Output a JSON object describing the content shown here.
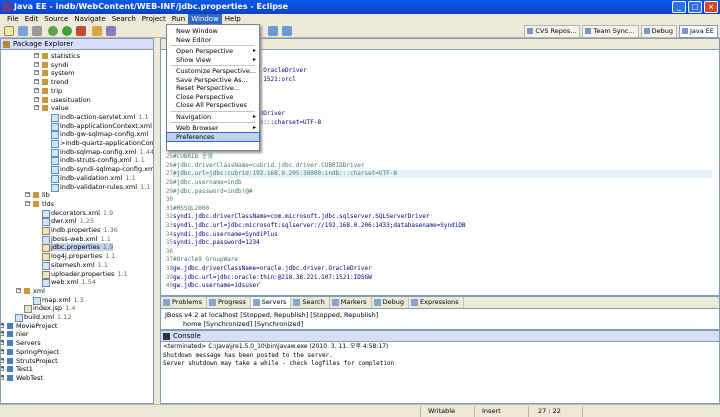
{
  "window": {
    "title": "Java EE - indb/WebContent/WEB-INF/jdbc.properties - Eclipse"
  },
  "menubar": [
    "File",
    "Edit",
    "Source",
    "Navigate",
    "Search",
    "Project",
    "Run",
    "Window",
    "Help"
  ],
  "perspectives": [
    "CVS Repos...",
    "Team Sync...",
    "Debug",
    "Java EE"
  ],
  "window_menu": {
    "items": [
      {
        "label": "New Window",
        "submenu": false
      },
      {
        "label": "New Editor",
        "submenu": false
      },
      {
        "sep": true
      },
      {
        "label": "Open Perspective",
        "submenu": true
      },
      {
        "label": "Show View",
        "submenu": true
      },
      {
        "sep": true
      },
      {
        "label": "Customize Perspective...",
        "submenu": false
      },
      {
        "label": "Save Perspective As...",
        "submenu": false
      },
      {
        "label": "Reset Perspective...",
        "submenu": false
      },
      {
        "label": "Close Perspective",
        "submenu": false
      },
      {
        "label": "Close All Perspectives",
        "submenu": false
      },
      {
        "sep": true
      },
      {
        "label": "Navigation",
        "submenu": true
      },
      {
        "sep": true
      },
      {
        "label": "Web Browser",
        "submenu": true
      },
      {
        "label": "Preferences",
        "submenu": false,
        "highlight": true
      }
    ]
  },
  "package_explorer": {
    "title": "Package Explorer",
    "items": [
      {
        "label": "statistics",
        "type": "pkg",
        "indent": 3
      },
      {
        "label": "syndi",
        "type": "pkg",
        "indent": 3
      },
      {
        "label": "system",
        "type": "pkg",
        "indent": 3
      },
      {
        "label": "trend",
        "type": "pkg",
        "indent": 3
      },
      {
        "label": "trip",
        "type": "pkg",
        "indent": 3
      },
      {
        "label": "usesituation",
        "type": "pkg",
        "indent": 3
      },
      {
        "label": "value",
        "type": "pkg",
        "indent": 3
      },
      {
        "label": "indb-action-servlet.xml",
        "rev": "1.1",
        "type": "xml",
        "indent": 4
      },
      {
        "label": "indb-applicationContext.xml",
        "rev": "",
        "type": "xml",
        "indent": 4
      },
      {
        "label": "indb-gw-sqlmap-config.xml",
        "rev": "",
        "type": "xml",
        "indent": 4
      },
      {
        "label": ">indb-quartz-applicationCont",
        "rev": "",
        "type": "xml",
        "indent": 4
      },
      {
        "label": "indb-sqlmap-config.xml",
        "rev": "1.44",
        "type": "xml",
        "indent": 4
      },
      {
        "label": "indb-struts-config.xml",
        "rev": "1.1",
        "type": "xml",
        "indent": 4
      },
      {
        "label": "indb-syndi-sqlmap-config.xm",
        "rev": "",
        "type": "xml",
        "indent": 4
      },
      {
        "label": "indb-validation.xml",
        "rev": "1.1",
        "type": "xml",
        "indent": 4
      },
      {
        "label": "indb-validator-rules.xml",
        "rev": "1.1",
        "type": "xml",
        "indent": 4
      },
      {
        "label": "lib",
        "type": "pkg",
        "indent": 2
      },
      {
        "label": "tlds",
        "type": "pkg",
        "indent": 2
      },
      {
        "label": "decorators.xml",
        "rev": "1.9",
        "type": "xml",
        "indent": 3
      },
      {
        "label": "dwr.xml",
        "rev": "1.25",
        "type": "xml",
        "indent": 3
      },
      {
        "label": "indb.properties",
        "rev": "1.36",
        "type": "prop",
        "indent": 3
      },
      {
        "label": "jboss-web.xml",
        "rev": "1.1",
        "type": "xml",
        "indent": 3
      },
      {
        "label": "jdbc.properties",
        "rev": "1.9",
        "type": "prop",
        "indent": 3,
        "selected": true
      },
      {
        "label": "log4j.properties",
        "rev": "1.1",
        "type": "prop",
        "indent": 3
      },
      {
        "label": "sitemesh.xml",
        "rev": "1.1",
        "type": "xml",
        "indent": 3
      },
      {
        "label": "uploader.properties",
        "rev": "1.1",
        "type": "prop",
        "indent": 3
      },
      {
        "label": "web.xml",
        "rev": "1.54",
        "type": "xml",
        "indent": 3
      },
      {
        "label": "xml",
        "type": "pkg",
        "indent": 1
      },
      {
        "label": "map.xml",
        "rev": "1.3",
        "type": "xml",
        "indent": 2
      },
      {
        "label": "index.jsp",
        "rev": "1.4",
        "type": "file",
        "indent": 1
      },
      {
        "label": "build.xml",
        "rev": "1.12",
        "type": "xml",
        "indent": 0
      },
      {
        "label": "MovieProject",
        "rev": "",
        "type": "proj",
        "indent": -1
      },
      {
        "label": "nier",
        "rev": "",
        "type": "proj",
        "indent": -1
      },
      {
        "label": "Servers",
        "rev": "",
        "type": "proj",
        "indent": -1
      },
      {
        "label": "SpringProject",
        "rev": "",
        "type": "proj",
        "indent": -1
      },
      {
        "label": "StrutsProject",
        "rev": "",
        "type": "proj",
        "indent": -1
      },
      {
        "label": "Test1",
        "rev": "",
        "type": "proj",
        "indent": -1
      },
      {
        "label": "WebTest",
        "rev": "",
        "type": "proj",
        "indent": -1
      }
    ]
  },
  "editor": {
    "lines": [
      {
        "n": "",
        "t": ""
      },
      {
        "n": "",
        "t": ""
      },
      {
        "n": "",
        "t": "rName=oracle.jdbc.driver.OracleDriver",
        "c": "code"
      },
      {
        "n": "",
        "t": "er:thin:@125.131.226.196:1521:orcl",
        "c": "code"
      },
      {
        "n": "",
        "t": ""
      },
      {
        "n": "",
        "t": ""
      },
      {
        "n": "",
        "t": ""
      },
      {
        "n": "",
        "t": "cubrid.jdbc.driver.CUBRIDDriver",
        "c": "code"
      },
      {
        "n": "",
        "t": ":192.168.1.211:30000:indb:::charset=UTF-8",
        "c": "code"
      },
      {
        "n": "",
        "t": ""
      },
      {
        "n": "",
        "t": ""
      },
      {
        "n": "",
        "t": ""
      },
      {
        "n": "25",
        "t": "#CUBRID 운영",
        "c": "comment"
      },
      {
        "n": "26",
        "t": "#jdbc.driverClassName=cubrid.jdbc.driver.CUBRIDDriver",
        "c": "comment"
      },
      {
        "n": "27",
        "t": "#jdbc.url=jdbc:cubrid:192.168.0.205:30000:indb:::charset=UTF-8",
        "c": "comment",
        "hl": true
      },
      {
        "n": "28",
        "t": "#jdbc.username=indb",
        "c": "comment"
      },
      {
        "n": "29",
        "t": "#jdbc.password=indb!@#",
        "c": "comment"
      },
      {
        "n": "30",
        "t": ""
      },
      {
        "n": "31",
        "t": "#MSSQL2000",
        "c": "comment"
      },
      {
        "n": "32",
        "t": "syndi.jdbc.driverClassName=com.microsoft.jdbc.sqlserver.SQLServerDriver",
        "c": "code"
      },
      {
        "n": "33",
        "t": "syndi.jdbc.url=jdbc:microsoft:sqlserver://192.168.0.206:1433;databasename=SyndiDB",
        "c": "code"
      },
      {
        "n": "34",
        "t": "syndi.jdbc.username=SyndiPlus",
        "c": "code"
      },
      {
        "n": "35",
        "t": "syndi.jdbc.password=1234",
        "c": "code"
      },
      {
        "n": "36",
        "t": ""
      },
      {
        "n": "37",
        "t": "#Oracle9 GroupWare",
        "c": "comment"
      },
      {
        "n": "38",
        "t": "gw.jdbc.driverClassName=oracle.jdbc.driver.OracleDriver",
        "c": "code"
      },
      {
        "n": "39",
        "t": "gw.jdbc.url=jdbc:oracle:thin:@218.38.221.107:1521:IDSGW",
        "c": "code"
      },
      {
        "n": "40",
        "t": "gw.jdbc.username=idsuser",
        "c": "code"
      }
    ]
  },
  "views": {
    "tabs": [
      "Problems",
      "Progress",
      "Servers",
      "Search",
      "Markers",
      "Debug",
      "Expressions"
    ],
    "server_line": "JBoss v4.2 at localhost  [Stopped, Republish]  [Stopped, Republish]",
    "server_child": "home  [Synchronized]  [Synchronized]"
  },
  "console": {
    "title": "Console",
    "terminated": "<terminated> C:\\Java\\jre1.5.0_10\\bin\\javaw.exe (2010. 3. 11. 오후 4:58:17)",
    "lines": [
      "Shutdown message has been posted to the server.",
      "Server shutdown may take a while - check logfiles for completion"
    ]
  },
  "status": {
    "writable": "Writable",
    "insert": "Insert",
    "position": "27 : 22"
  },
  "colors": {
    "comment": "#3f7f5f",
    "key": "#000080",
    "value": "#2a00ff",
    "selection": "#c1d2ee"
  }
}
